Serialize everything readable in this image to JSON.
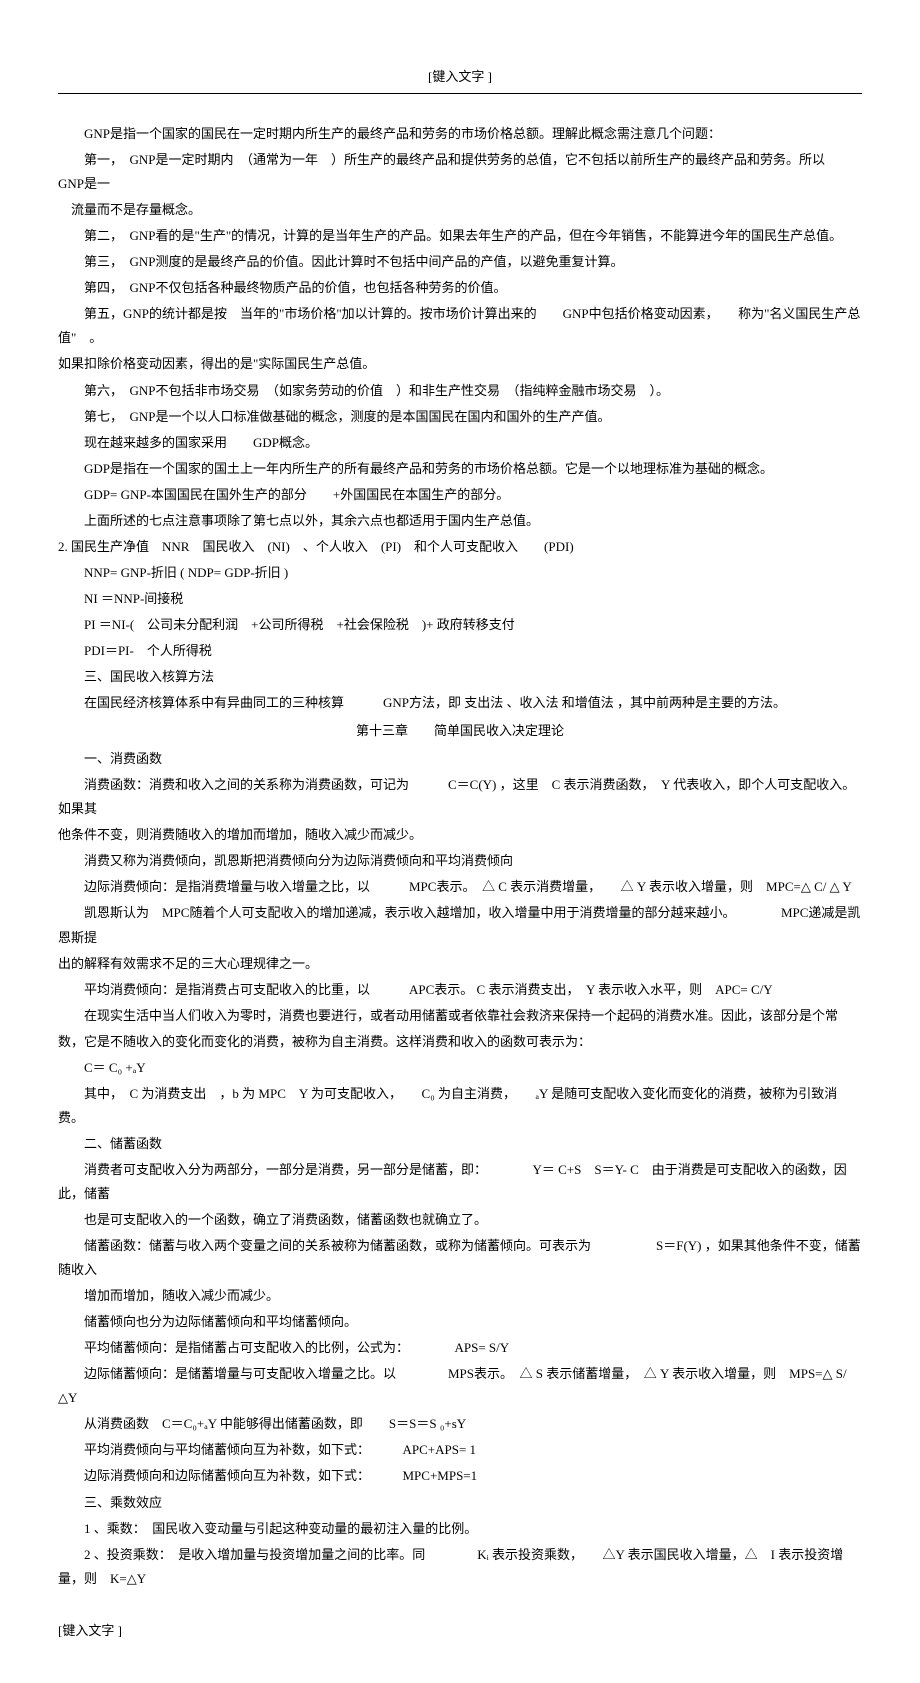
{
  "header": "[键入文字 ]",
  "footer": "[键入文字 ]",
  "p1": "GNP是指一个国家的国民在一定时期内所生产的最终产品和劳务的市场价格总额。理解此概念需注意几个问题：",
  "p2": "第一，　GNP是一定时期内　（通常为一年　）所生产的最终产品和提供劳务的总值，它不包括以前所生产的最终产品和劳务。所以　　　GNP是一",
  "p2b": "　流量而不是存量概念。",
  "p3": "第二，　GNP看的是\"生产\"的情况，计算的是当年生产的产品。如果去年生产的产品，但在今年销售，不能算进今年的国民生产总值。",
  "p4": "第三，　GNP测度的是最终产品的价值。因此计算时不包括中间产品的产值，以避免重复计算。",
  "p5": "第四，　GNP不仅包括各种最终物质产品的价值，也包括各种劳务的价值。",
  "p6a": "第五，GNP的统计都是按　当年的\"市场价格\"加以计算的。按市场价计算出来的　　GNP中包括价格变动因素，　　称为\"名义国民生产总值\"　。",
  "p6b": "如果扣除价格变动因素，得出的是\"实际国民生产总值。",
  "p7": "第六，　GNP不包括非市场交易　（如家务劳动的价值　）和非生产性交易　（指纯粹金融市场交易　）。",
  "p8": "第七，　GNP是一个以人口标准做基础的概念，测度的是本国国民在国内和国外的生产产值。",
  "p9": "现在越来越多的国家采用　　GDP概念。",
  "p10": "GDP是指在一个国家的国土上一年内所生产的所有最终产品和劳务的市场价格总额。它是一个以地理标准为基础的概念。",
  "p11": "GDP= GNP-本国国民在国外生产的部分　　+外国国民在本国生产的部分。",
  "p12": "上面所述的七点注意事项除了第七点以外，其余六点也都适用于国内生产总值。",
  "s2": "2. 国民生产净值　NNR　国民收入　(NI)　、个人收入　(PI)　和个人可支配收入　　(PDI)",
  "p13": "NNP= GNP-折旧 ( NDP= GDP-折旧 )",
  "p14": "NI ＝NNP-间接税",
  "p15": "PI ＝NI-(　公司未分配利润　+公司所得税　+社会保险税　)+ 政府转移支付",
  "p16": "PDI＝PI-　个人所得税",
  "p17": "三、国民收入核算方法",
  "p18": "在国民经济核算体系中有异曲同工的三种核算　　　GNP方法，即 支出法 、收入法 和增值法 ，其中前两种是主要的方法。",
  "ch13": "第十三章　　简单国民收入决定理论",
  "p19": "一、消费函数",
  "p20a": "消费函数：消费和收入之间的关系称为消费函数，可记为　　　C＝C(Y) ，这里　C 表示消费函数，　Y 代表收入，即个人可支配收入。如果其",
  "p20b": "他条件不变，则消费随收入的增加而增加，随收入减少而减少。",
  "p21": "消费又称为消费倾向，凯恩斯把消费倾向分为边际消费倾向和平均消费倾向",
  "p22": "边际消费倾向：是指消费增量与收入增量之比，以　　　MPC表示。　△ C 表示消费增量，　　△ Y 表示收入增量，则　MPC=△ C/ △ Y",
  "p23a": "凯恩斯认为　MPC随着个人可支配收入的增加递减，表示收入越增加，收入增量中用于消费增量的部分越来越小。　　　　MPC递减是凯恩斯提",
  "p23b": "出的解释有效需求不足的三大心理规律之一。",
  "p24": "平均消费倾向：是指消费占可支配收入的比重，以　　　APC表示。 C 表示消费支出，　Y 表示收入水平，则　APC= C/Y",
  "p25a": "在现实生活中当人们收入为零时，消费也要进行，或者动用储蓄或者依靠社会救济来保持一个起码的消费水准。因此，该部分是个常",
  "p25b": "数，它是不随收入的变化而变化的消费，被称为自主消费。这样消费和收入的函数可表示为：",
  "p26": "C＝ C₀ +ₐY",
  "p27": "其中，　C 为消费支出　，b 为 MPC　Y 为可支配收入，　　C₀ 为自主消费，　　ₐY 是随可支配收入变化而变化的消费，被称为引致消费。",
  "p28": "二、储蓄函数",
  "p29a": "消费者可支配收入分为两部分，一部分是消费，另一部分是储蓄，即：　　　　Y＝ C+S　S＝Y- C　由于消费是可支配收入的函数，因此，储蓄",
  "p29b": "也是可支配收入的一个函数，确立了消费函数，储蓄函数也就确立了。",
  "p30a": "储蓄函数：储蓄与收入两个变量之间的关系被称为储蓄函数，或称为储蓄倾向。可表示为　　　　　S＝F(Y) ，如果其他条件不变，储蓄随收入",
  "p30b": "增加而增加，随收入减少而减少。",
  "p31": "储蓄倾向也分为边际储蓄倾向和平均储蓄倾向。",
  "p32": "平均储蓄倾向：是指储蓄占可支配收入的比例，公式为：　　　　APS= S/Y",
  "p33": "边际储蓄倾向：是储蓄增量与可支配收入增量之比。以　　　　MPS表示。　△ S 表示储蓄增量，　△ Y 表示收入增量，则　MPS=△ S/ △Y",
  "p34": "从消费函数　C＝C₀+ₐY 中能够得出储蓄函数，即　　S＝S＝S ₀+sY",
  "p35": "平均消费倾向与平均储蓄倾向互为补数，如下式：　　　APC+APS= 1",
  "p36": "边际消费倾向和边际储蓄倾向互为补数，如下式：　　　MPC+MPS=1",
  "p37": "三、乘数效应",
  "p38": "1 、乘数：　国民收入变动量与引起这种变动量的最初注入量的比例。",
  "p39": "2 、投资乘数：　是收入增加量与投资增加量之间的比率。同　　　　Kᵢ 表示投资乘数，　　△Y 表示国民收入增量，△　I 表示投资增量，则　K=△Y"
}
